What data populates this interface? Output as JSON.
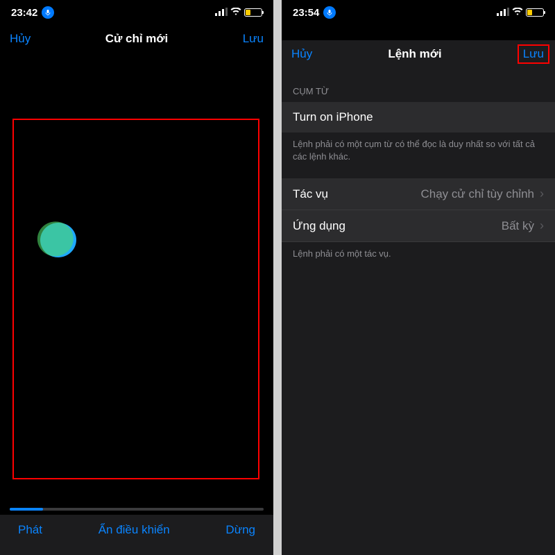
{
  "left": {
    "status": {
      "time": "23:42"
    },
    "nav": {
      "cancel": "Hủy",
      "title": "Cử chỉ mới",
      "save": "Lưu"
    },
    "toolbar": {
      "play": "Phát",
      "hide": "Ẩn điều khiển",
      "stop": "Dừng"
    }
  },
  "right": {
    "status": {
      "time": "23:54"
    },
    "nav": {
      "cancel": "Hủy",
      "title": "Lệnh mới",
      "save": "Lưu"
    },
    "section1": {
      "header": "CỤM TỪ",
      "input": "Turn on iPhone",
      "footer": "Lệnh phải có một cụm từ có thể đọc là duy nhất so với tất cả các lệnh khác."
    },
    "rows": {
      "task": {
        "label": "Tác vụ",
        "value": "Chạy cử chỉ tùy chỉnh"
      },
      "app": {
        "label": "Ứng dụng",
        "value": "Bất kỳ"
      }
    },
    "footer2": "Lệnh phải có một tác vụ."
  }
}
